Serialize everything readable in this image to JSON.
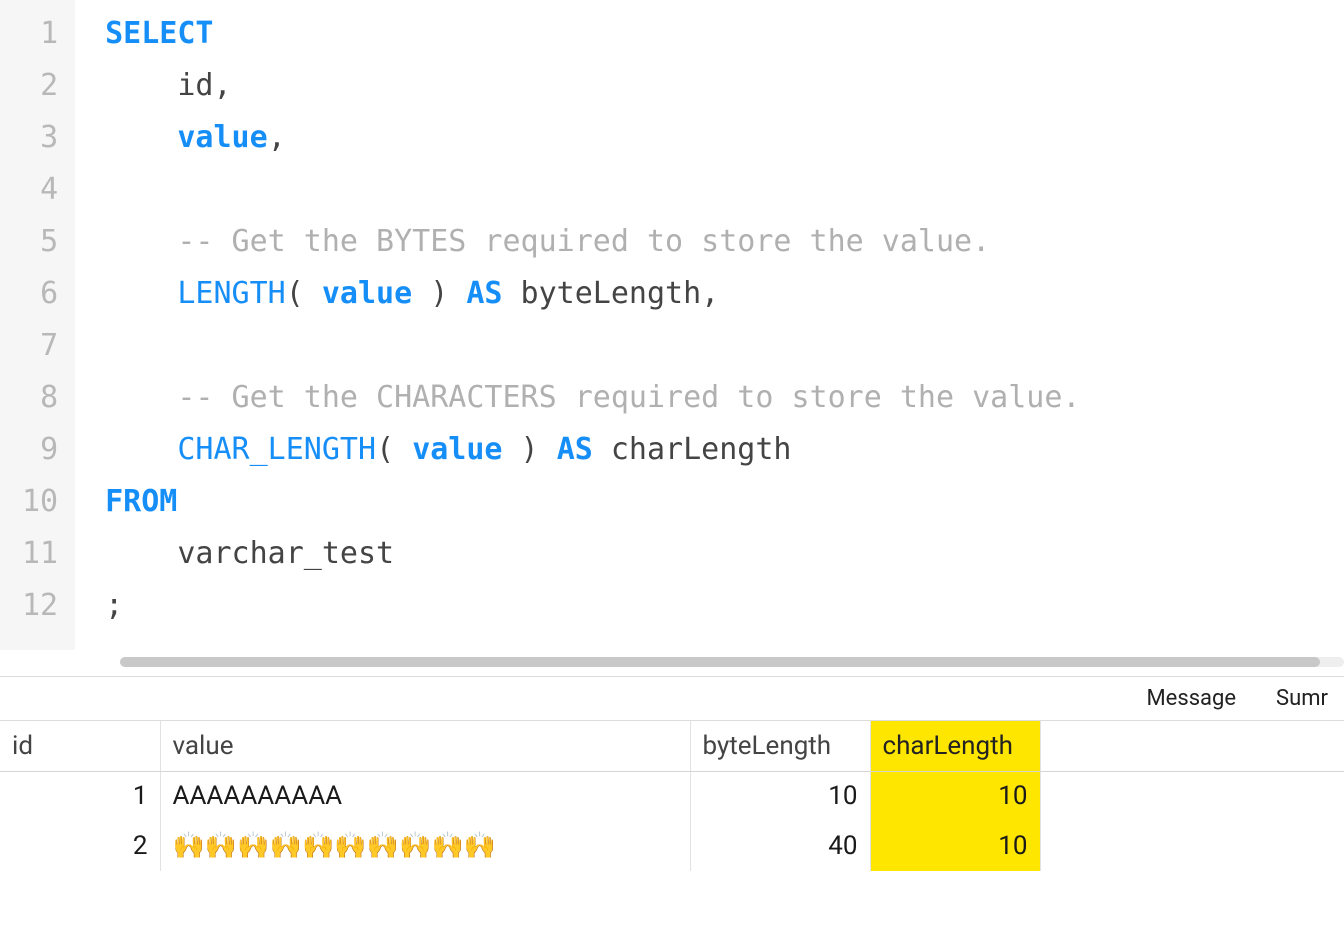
{
  "editor": {
    "lines": [
      {
        "n": 1,
        "tokens": [
          {
            "t": "SELECT",
            "c": "kw"
          }
        ]
      },
      {
        "n": 2,
        "tokens": [
          {
            "t": "    id,",
            "c": "id"
          }
        ]
      },
      {
        "n": 3,
        "tokens": [
          {
            "t": "    ",
            "c": "id"
          },
          {
            "t": "value",
            "c": "kw"
          },
          {
            "t": ",",
            "c": "id"
          }
        ]
      },
      {
        "n": 4,
        "tokens": []
      },
      {
        "n": 5,
        "tokens": [
          {
            "t": "    ",
            "c": "id"
          },
          {
            "t": "-- Get the BYTES required to store the value.",
            "c": "cm"
          }
        ]
      },
      {
        "n": 6,
        "tokens": [
          {
            "t": "    ",
            "c": "id"
          },
          {
            "t": "LENGTH",
            "c": "fn"
          },
          {
            "t": "( ",
            "c": "id"
          },
          {
            "t": "value",
            "c": "kw"
          },
          {
            "t": " ) ",
            "c": "id"
          },
          {
            "t": "AS",
            "c": "kw"
          },
          {
            "t": " byteLength,",
            "c": "id"
          }
        ]
      },
      {
        "n": 7,
        "tokens": []
      },
      {
        "n": 8,
        "tokens": [
          {
            "t": "    ",
            "c": "id"
          },
          {
            "t": "-- Get the CHARACTERS required to store the value.",
            "c": "cm"
          }
        ]
      },
      {
        "n": 9,
        "tokens": [
          {
            "t": "    ",
            "c": "id"
          },
          {
            "t": "CHAR_LENGTH",
            "c": "fn"
          },
          {
            "t": "( ",
            "c": "id"
          },
          {
            "t": "value",
            "c": "kw"
          },
          {
            "t": " ) ",
            "c": "id"
          },
          {
            "t": "AS",
            "c": "kw"
          },
          {
            "t": " charLength",
            "c": "id"
          }
        ]
      },
      {
        "n": 10,
        "tokens": [
          {
            "t": "FROM",
            "c": "kw"
          }
        ]
      },
      {
        "n": 11,
        "tokens": [
          {
            "t": "    varchar_test",
            "c": "id"
          }
        ]
      },
      {
        "n": 12,
        "tokens": [
          {
            "t": ";",
            "c": "id"
          }
        ]
      }
    ]
  },
  "tabs": {
    "message": "Message",
    "summary_partial": "Sumr"
  },
  "results": {
    "columns": {
      "id": "id",
      "value": "value",
      "byteLength": "byteLength",
      "charLength": "charLength"
    },
    "highlight_column": "charLength",
    "rows": [
      {
        "id": "1",
        "value": "AAAAAAAAAA",
        "byteLength": "10",
        "charLength": "10"
      },
      {
        "id": "2",
        "value": "🙌🙌🙌🙌🙌🙌🙌🙌🙌🙌",
        "byteLength": "40",
        "charLength": "10"
      }
    ]
  }
}
